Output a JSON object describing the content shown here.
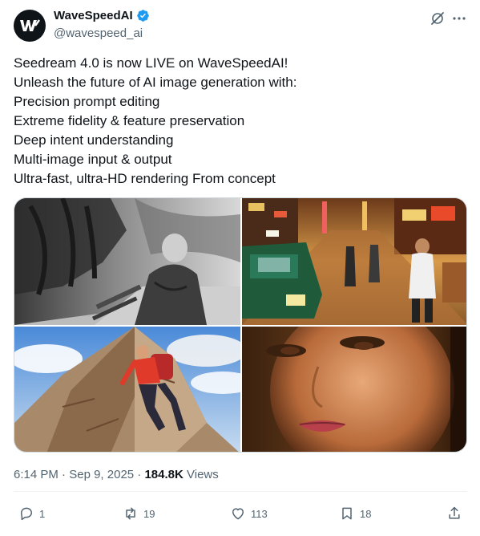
{
  "author": {
    "display_name": "WaveSpeedAI",
    "handle": "@wavespeed_ai",
    "avatar_icon": "wavespeed-logo",
    "verified_color": "#1d9bf0"
  },
  "header_icons": [
    "grok-icon",
    "more-icon"
  ],
  "tweet": {
    "lines": [
      "Seedream 4.0 is now LIVE on WaveSpeedAI!",
      "Unleash the future of AI image generation with:",
      "Precision prompt editing",
      "Extreme fidelity & feature preservation",
      "Deep intent understanding",
      "Multi-image input & output",
      "Ultra-fast, ultra-HD rendering From concept"
    ]
  },
  "media": [
    {
      "subject": "elderly man on bench in misty park, black and white"
    },
    {
      "subject": "busy city street with taxi at sunset"
    },
    {
      "subject": "hiker climbing rocky mountain"
    },
    {
      "subject": "close-up of woman's face in golden light"
    }
  ],
  "meta": {
    "time": "6:14 PM",
    "sep1": "·",
    "date": "Sep 9, 2025",
    "sep2": "·",
    "views_count": "184.8K",
    "views_label": "Views"
  },
  "actions": {
    "replies": "1",
    "reposts": "19",
    "likes": "113",
    "bookmarks": "18"
  },
  "colors": {
    "text": "#0f1419",
    "secondary": "#536471",
    "accent": "#1d9bf0",
    "border": "#cfd9de"
  }
}
